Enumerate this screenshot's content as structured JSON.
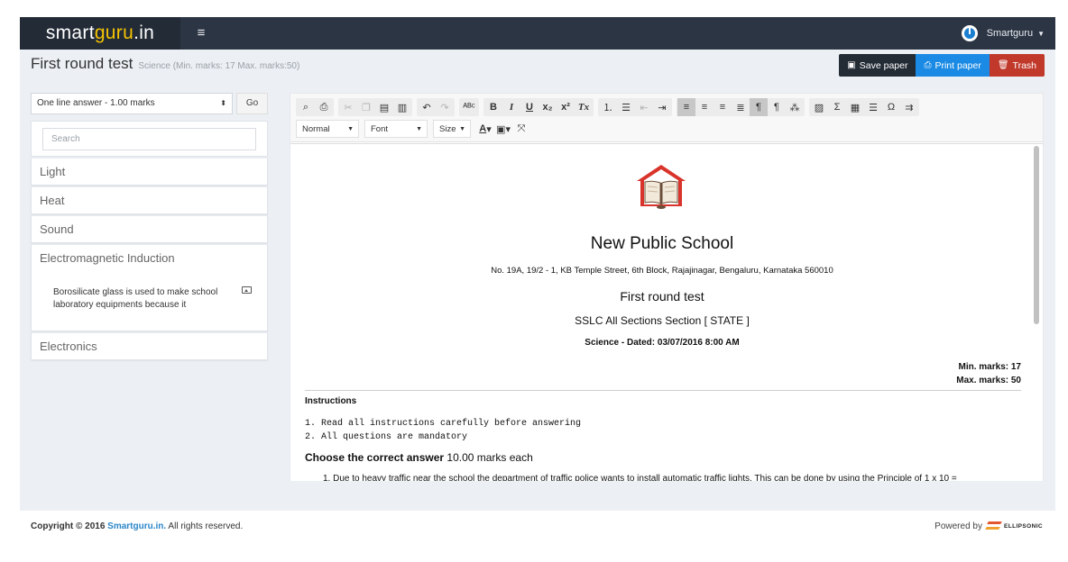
{
  "navbar": {
    "brand_part1": "smart",
    "brand_part2": "guru",
    "brand_part3": ".in",
    "menu_icon": "hamburger-icon",
    "user_name": "Smartguru",
    "accent": "#f5c400"
  },
  "header": {
    "title": "First round test",
    "subtitle": "Science (Min. marks: 17 Max. marks:50)",
    "save_label": "Save paper",
    "print_label": "Print paper",
    "trash_label": "Trash"
  },
  "left": {
    "selected_type": "One line answer - 1.00 marks",
    "go_label": "Go",
    "search_placeholder": "Search",
    "categories": [
      "Light",
      "Heat",
      "Sound",
      "Electromagnetic Induction",
      "Electronics"
    ],
    "open_question": "Borosilicate glass is used to make school laboratory equipments because it"
  },
  "editor": {
    "format_combo": "Normal",
    "font_combo": "Font",
    "size_combo": "Size"
  },
  "document": {
    "school_name": "New Public School",
    "address": "No. 19A, 19/2 - 1, KB Temple Street, 6th Block, Rajajinagar, Bengaluru, Karnataka 560010",
    "test_name": "First round test",
    "section": "SSLC All Sections Section [ STATE ]",
    "dated": "Science - Dated: 03/07/2016 8:00 AM",
    "min_marks": "Min. marks: 17",
    "max_marks": "Max. marks: 50",
    "instructions_heading": "Instructions",
    "instructions": [
      "1. Read all instructions carefully before answering",
      "2. All questions are mandatory"
    ],
    "choose_bold": "Choose the correct answer",
    "choose_marks": " 10.00 marks each",
    "question_1": "1. Due to heavy traffic near the school the department of traffic police wants to install automatic traffic lights. This can be done by using the Principle of 1 x 10 ="
  },
  "footer": {
    "copyright_prefix": "Copyright © 2016",
    "site": "Smartguru.in.",
    "rights": "All rights reserved.",
    "powered_by": "Powered by",
    "company": "ELLIPSONIC"
  },
  "colors": {
    "navbar": "#2c3544",
    "save": "#232b35",
    "print": "#1a8ae4",
    "trash": "#c0392b",
    "logo_red": "#d9342b"
  }
}
